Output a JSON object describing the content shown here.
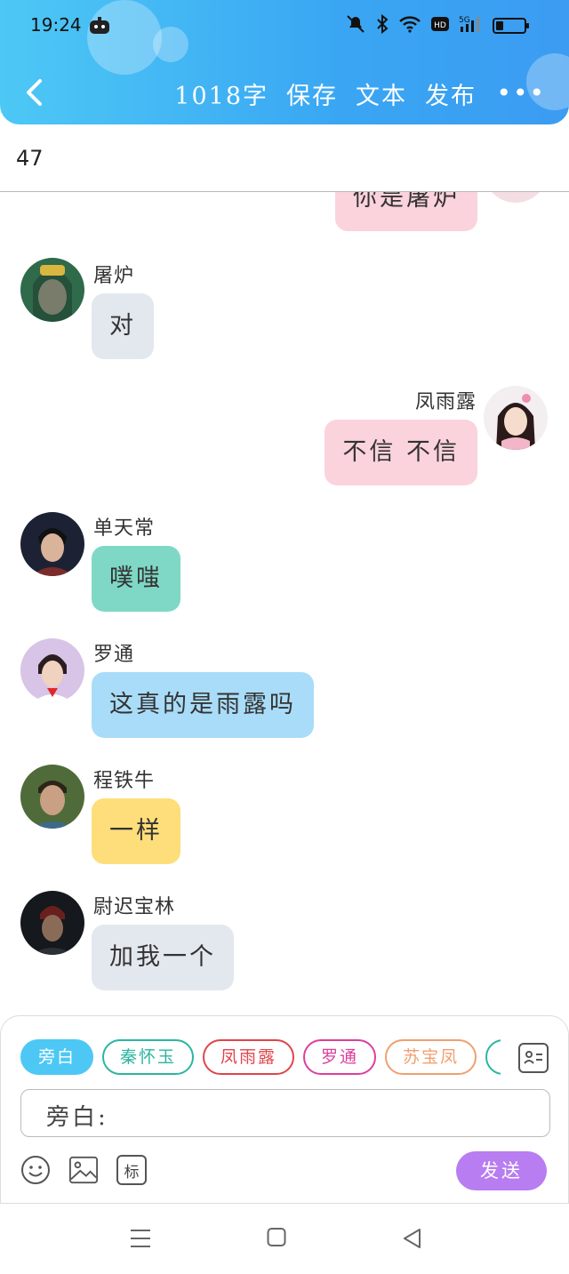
{
  "status": {
    "time": "19:24",
    "battery_level": 0.25
  },
  "toolbar": {
    "word_count": "1018字",
    "save_label": "保存",
    "text_label": "文本",
    "publish_label": "发布",
    "more_label": "•••"
  },
  "episode_count": "47",
  "messages": [
    {
      "speaker": "",
      "text": "你是屠炉",
      "side": "right",
      "bubble_color": "#fbd3dc"
    },
    {
      "speaker": "屠炉",
      "text": "对",
      "side": "left",
      "bubble_color": "#e3e7ee"
    },
    {
      "speaker": "凤雨露",
      "text": "不信 不信",
      "side": "right",
      "bubble_color": "#fbd3dc"
    },
    {
      "speaker": "单天常",
      "text": "噗嗤",
      "side": "left",
      "bubble_color": "#7fd8c6"
    },
    {
      "speaker": "罗通",
      "text": "这真的是雨露吗",
      "side": "left",
      "bubble_color": "#a9dcf8"
    },
    {
      "speaker": "程铁牛",
      "text": "一样",
      "side": "left",
      "bubble_color": "#fede7a"
    },
    {
      "speaker": "尉迟宝林",
      "text": "加我一个",
      "side": "left",
      "bubble_color": "#e3e7ee"
    }
  ],
  "composer": {
    "roles": [
      {
        "label": "旁白",
        "color": "#4dc8f5",
        "active": true
      },
      {
        "label": "秦怀玉",
        "color": "#2bb5a0",
        "active": false
      },
      {
        "label": "凤雨露",
        "color": "#e0444c",
        "active": false
      },
      {
        "label": "罗通",
        "color": "#dc3f9c",
        "active": false
      },
      {
        "label": "苏宝凤",
        "color": "#f0a070",
        "active": false
      },
      {
        "label": "",
        "color": "#2bb5a0",
        "active": false
      }
    ],
    "input_label": "旁白:",
    "tag_label": "标",
    "send_label": "发送"
  },
  "colors": {
    "header_start": "#4dc8f5",
    "header_end": "#3b9cf2",
    "send_button": "#b87df0"
  }
}
